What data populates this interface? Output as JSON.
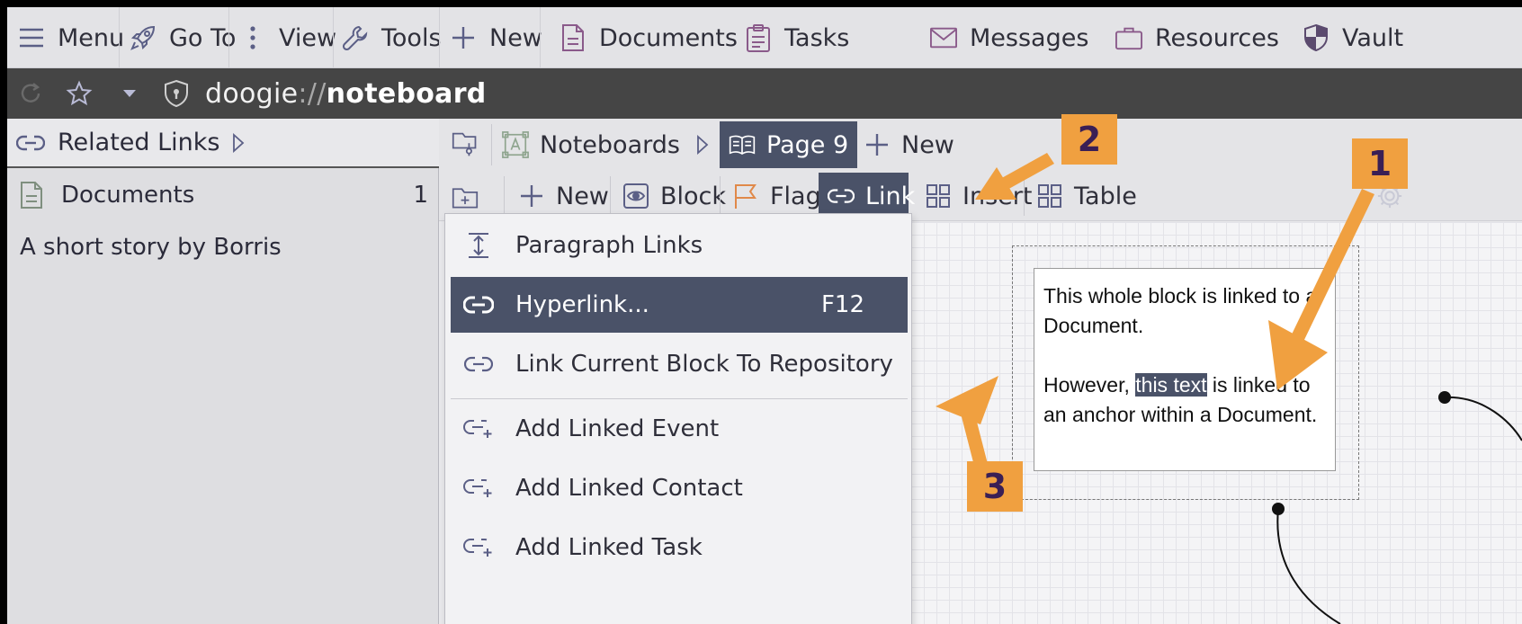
{
  "menubar": {
    "items": [
      {
        "label": "Menu",
        "icon": "hamburger-icon"
      },
      {
        "label": "Go To",
        "icon": "rocket-icon"
      },
      {
        "label": "View",
        "icon": "vertical-dots-icon"
      },
      {
        "label": "Tools",
        "icon": "wrench-icon"
      },
      {
        "label": "New",
        "icon": "plus-icon"
      },
      {
        "label": "Documents",
        "icon": "document-icon"
      },
      {
        "label": "Tasks",
        "icon": "clipboard-icon"
      },
      {
        "label": "Messages",
        "icon": "envelope-icon"
      },
      {
        "label": "Resources",
        "icon": "briefcase-icon"
      },
      {
        "label": "Vault",
        "icon": "shield-icon"
      }
    ]
  },
  "address": {
    "scheme": "doogie",
    "separator": "://",
    "host": "noteboard"
  },
  "left_panel": {
    "header": "Related Links",
    "documents_label": "Documents",
    "documents_count": "1",
    "doc_item": "A short story by Borris"
  },
  "tabs": {
    "noteboards": "Noteboards",
    "page": "Page 9",
    "new": "New"
  },
  "toolbar": {
    "new": "New",
    "block": "Block",
    "flag": "Flag",
    "link": "Link",
    "insert": "Insert",
    "table": "Table"
  },
  "link_menu": {
    "items": [
      {
        "label": "Paragraph Links",
        "shortcut": ""
      },
      {
        "label": "Hyperlink...",
        "shortcut": "F12"
      },
      {
        "label": "Link Current Block To Repository",
        "shortcut": ""
      },
      {
        "label": "Add Linked Event",
        "shortcut": ""
      },
      {
        "label": "Add Linked Contact",
        "shortcut": ""
      },
      {
        "label": "Add Linked Task",
        "shortcut": ""
      }
    ]
  },
  "note": {
    "line1": "This whole block is linked to a Document.",
    "before": "However, ",
    "highlight": "this text",
    "after": " is linked to an anchor within a Document."
  },
  "callouts": [
    "1",
    "2",
    "3"
  ],
  "colors": {
    "accent": "#4a5268",
    "callout": "#f0a040",
    "callout_text": "#3a1f55",
    "addressbar": "#454545"
  }
}
